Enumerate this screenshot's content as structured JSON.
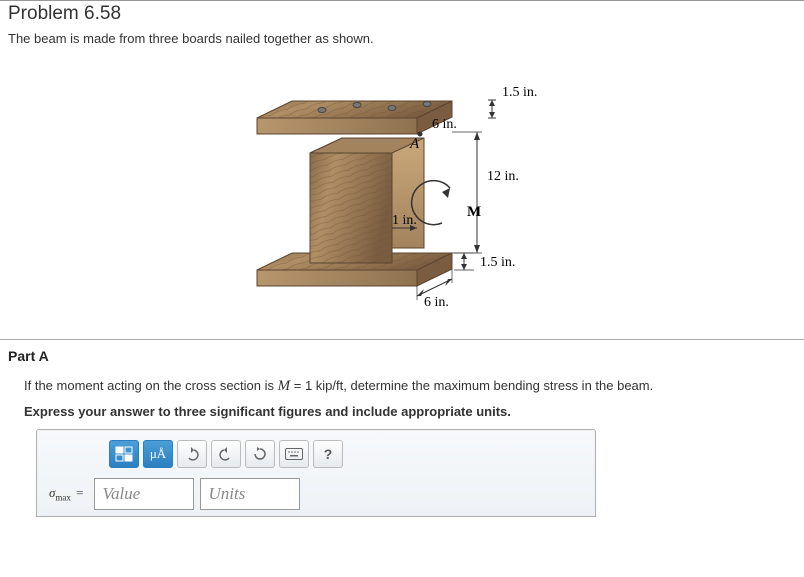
{
  "header": {
    "title": "Problem 6.58",
    "description": "The beam is made from three boards nailed together as shown."
  },
  "figure": {
    "labels": {
      "top_thickness": "1.5 in.",
      "top_width": "6 in.",
      "web_height": "12 in.",
      "web_thickness": "1 in.",
      "bottom_thickness": "1.5 in.",
      "bottom_width": "6 in.",
      "point_A": "A",
      "moment": "M"
    }
  },
  "part_a": {
    "heading": "Part A",
    "text_before_var": "If the moment acting on the cross section is ",
    "moment_var": "M",
    "text_eq": " = 1 kip/ft",
    "text_after": ", determine the maximum bending stress in the beam.",
    "instruction": "Express your answer to three significant figures and include appropriate units."
  },
  "toolbar": {
    "templates": "templates-icon",
    "units_mu": "μÅ",
    "undo": "↶",
    "redo": "↷",
    "reset": "↻",
    "keyboard": "⌨",
    "help": "?"
  },
  "answer": {
    "sigma": "σ",
    "sub": "max",
    "equals": "=",
    "value_placeholder": "Value",
    "units_placeholder": "Units"
  }
}
